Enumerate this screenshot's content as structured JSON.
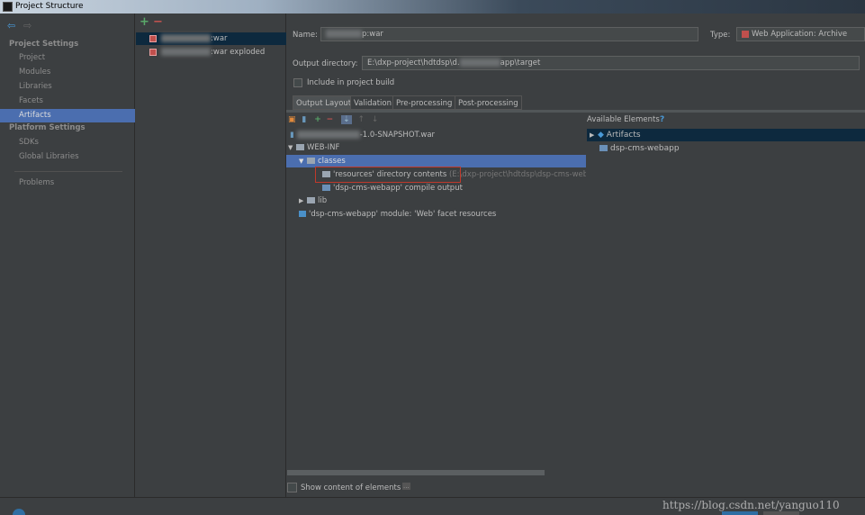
{
  "window": {
    "title": "Project Structure"
  },
  "sidebar": {
    "section1": "Project Settings",
    "items1": [
      "Project",
      "Modules",
      "Libraries",
      "Facets",
      "Artifacts"
    ],
    "section2": "Platform Settings",
    "items2": [
      "SDKs",
      "Global Libraries"
    ],
    "problems": "Problems"
  },
  "artifacts": {
    "add": "+",
    "remove": "−",
    "items": [
      ":war",
      ":war exploded"
    ]
  },
  "form": {
    "name_label": "Name:",
    "name_value": "p:war",
    "type_label": "Type:",
    "type_value": "Web Application: Archive",
    "output_label": "Output directory:",
    "output_value_a": "E:\\dxp-project\\hdtdsp\\d.",
    "output_value_b": "app\\target",
    "include_label": "Include in project build"
  },
  "tabs": [
    "Output Layout",
    "Validation",
    "Pre-processing",
    "Post-processing"
  ],
  "layout_tree": {
    "root": "-1.0-SNAPSHOT.war",
    "webinf": "WEB-INF",
    "classes": "classes",
    "resources": "'resources' directory contents",
    "resources_path": "(E:\\dxp-project\\hdtdsp\\dsp-cms-webapp",
    "compile": "'dsp-cms-webapp' compile output",
    "lib": "lib",
    "facet": "'dsp-cms-webapp' module: 'Web' facet resources"
  },
  "available": {
    "title": "Available Elements",
    "help": "?",
    "items": [
      "Artifacts",
      "dsp-cms-webapp"
    ]
  },
  "bottom": {
    "show_content": "Show content of elements",
    "more": "...",
    "watermark": "https://blog.csdn.net/yanguo110"
  },
  "colors": {
    "bg": "#3c3f41",
    "selection": "#4b6eaf",
    "accent_red": "#c0392b"
  }
}
